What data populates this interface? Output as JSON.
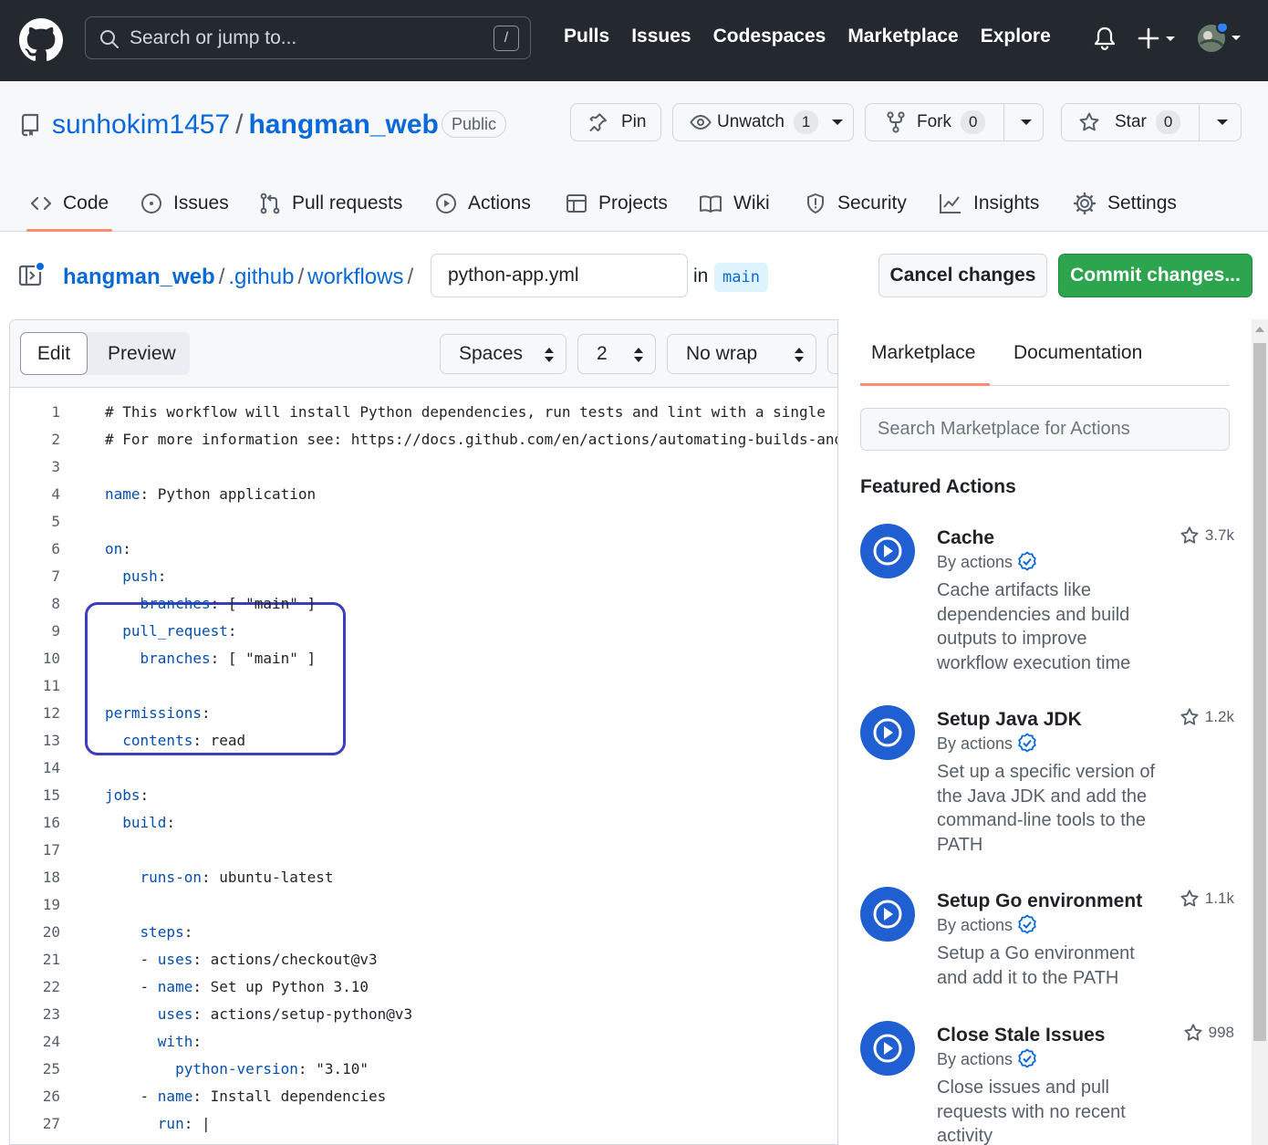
{
  "header": {
    "search_placeholder": "Search or jump to...",
    "search_shortcut": "/",
    "nav": [
      "Pulls",
      "Issues",
      "Codespaces",
      "Marketplace",
      "Explore"
    ]
  },
  "repo": {
    "owner": "sunhokim1457",
    "name": "hangman_web",
    "visibility": "Public",
    "pin_label": "Pin",
    "watch_label": "Unwatch",
    "watch_count": "1",
    "fork_label": "Fork",
    "fork_count": "0",
    "star_label": "Star",
    "star_count": "0"
  },
  "tabs": [
    {
      "label": "Code",
      "icon": "code-icon"
    },
    {
      "label": "Issues",
      "icon": "issue-icon"
    },
    {
      "label": "Pull requests",
      "icon": "pull-request-icon"
    },
    {
      "label": "Actions",
      "icon": "play-icon"
    },
    {
      "label": "Projects",
      "icon": "table-icon"
    },
    {
      "label": "Wiki",
      "icon": "book-icon"
    },
    {
      "label": "Security",
      "icon": "shield-icon"
    },
    {
      "label": "Insights",
      "icon": "graph-icon"
    },
    {
      "label": "Settings",
      "icon": "gear-icon"
    }
  ],
  "editor_header": {
    "crumb_repo": "hangman_web",
    "crumb_dir1": ".github",
    "crumb_dir2": "workflows",
    "filename": "python-app.yml",
    "in_label": "in",
    "branch": "main",
    "cancel_label": "Cancel changes",
    "commit_label": "Commit changes..."
  },
  "toolbar": {
    "edit_label": "Edit",
    "preview_label": "Preview",
    "indent_mode": "Spaces",
    "indent_size": "2",
    "wrap_mode": "No wrap"
  },
  "code_lines": [
    "# This workflow will install Python dependencies, run tests and lint with a single",
    "# For more information see: https://docs.github.com/en/actions/automating-builds-and-tests",
    "",
    "name: Python application",
    "",
    "on:",
    "  push:",
    "    branches: [ \"main\" ]",
    "  pull_request:",
    "    branches: [ \"main\" ]",
    "",
    "permissions:",
    "  contents: read",
    "",
    "jobs:",
    "  build:",
    "",
    "    runs-on: ubuntu-latest",
    "",
    "    steps:",
    "    - uses: actions/checkout@v3",
    "    - name: Set up Python 3.10",
    "      uses: actions/setup-python@v3",
    "      with:",
    "        python-version: \"3.10\"",
    "    - name: Install dependencies",
    "      run: |"
  ],
  "sidebar": {
    "tab_marketplace": "Marketplace",
    "tab_documentation": "Documentation",
    "search_placeholder": "Search Marketplace for Actions",
    "featured_title": "Featured Actions",
    "actions": [
      {
        "name": "Cache",
        "by": "By actions",
        "desc": "Cache artifacts like dependencies and build outputs to improve workflow execution time",
        "stars": "3.7k"
      },
      {
        "name": "Setup Java JDK",
        "by": "By actions",
        "desc": "Set up a specific version of the Java JDK and add the command-line tools to the PATH",
        "stars": "1.2k"
      },
      {
        "name": "Setup Go environment",
        "by": "By actions",
        "desc": "Setup a Go environment and add it to the PATH",
        "stars": "1.1k"
      },
      {
        "name": "Close Stale Issues",
        "by": "By actions",
        "desc": "Close issues and pull requests with no recent activity",
        "stars": "998"
      }
    ]
  }
}
